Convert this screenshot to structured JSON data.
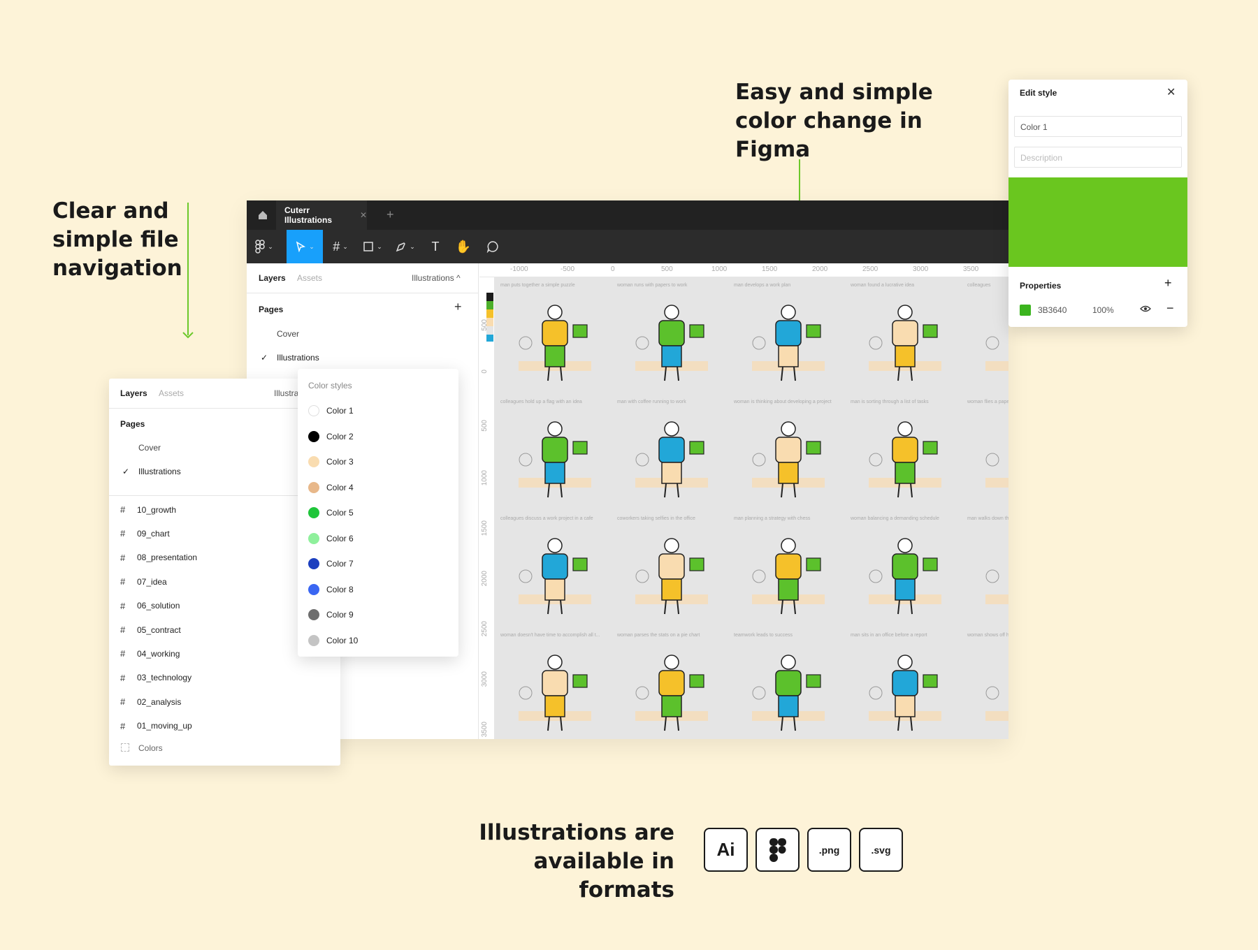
{
  "headings": {
    "left": "Clear and simple file navigation",
    "right": "Easy and simple color change in Figma",
    "bottom": "Illustrations are available in formats"
  },
  "figma": {
    "tab_title": "Cuterr Illustrations",
    "panel_tabs": [
      "Layers",
      "Assets"
    ],
    "page_dropdown": "Illustrations ^",
    "pages_label": "Pages",
    "pages": [
      "Cover",
      "Illustrations"
    ],
    "ruler_top": [
      "-1000",
      "-500",
      "0",
      "500",
      "1000",
      "1500",
      "2000",
      "2500",
      "3000",
      "3500"
    ],
    "ruler_left": [
      "500",
      "0",
      "500",
      "1000",
      "1500",
      "2000",
      "2500",
      "3000",
      "3500"
    ],
    "captions": [
      "man puts together a simple puzzle",
      "woman runs with papers to work",
      "man develops a work plan",
      "woman found a lucrative idea",
      "colleagues",
      "colleagues hold up a flag with an idea",
      "man with coffee running to work",
      "woman is thinking about developing a project",
      "man is sorting through a list of tasks",
      "woman flies a paper airplane",
      "colleagues discuss a work project in a cafe",
      "coworkers taking selfies in the office",
      "man planning a strategy with chess",
      "woman balancing a demanding schedule",
      "man walks down the stairs with his work done",
      "woman doesn't have time to accomplish all t...",
      "woman parses the stats on a pie chart",
      "teamwork leads to success",
      "man sits in an office before a report",
      "woman shows off her big to-do list"
    ]
  },
  "layers_panel": {
    "tabs": [
      "Layers",
      "Assets"
    ],
    "dropdown": "Illustra",
    "pages_label": "Pages",
    "pages": [
      "Cover",
      "Illustrations"
    ],
    "frames": [
      "10_growth",
      "09_chart",
      "08_presentation",
      "07_idea",
      "06_solution",
      "05_contract",
      "04_working",
      "03_technology",
      "02_analysis",
      "01_moving_up"
    ],
    "colors_item": "Colors"
  },
  "color_styles": {
    "title": "Color styles",
    "items": [
      {
        "label": "Color 1",
        "color": "#ffffff"
      },
      {
        "label": "Color 2",
        "color": "#000000"
      },
      {
        "label": "Color 3",
        "color": "#f9dcb0"
      },
      {
        "label": "Color 4",
        "color": "#e8b88a"
      },
      {
        "label": "Color 5",
        "color": "#1fc53a"
      },
      {
        "label": "Color 6",
        "color": "#8ff09c"
      },
      {
        "label": "Color 7",
        "color": "#1c3fbf"
      },
      {
        "label": "Color 8",
        "color": "#3a66f2"
      },
      {
        "label": "Color 9",
        "color": "#6e6e6e"
      },
      {
        "label": "Color 10",
        "color": "#c4c4c4"
      }
    ]
  },
  "edit_style": {
    "title": "Edit style",
    "name_value": "Color 1",
    "description_placeholder": "Description",
    "preview_color": "#6ac61f",
    "properties_label": "Properties",
    "hex": "3B3640",
    "opacity": "100%"
  },
  "formats": [
    "Ai",
    "Figma",
    ".png",
    ".svg"
  ],
  "colors": {
    "background": "#fdf3d8",
    "accent_green": "#6cc82a",
    "illustration_yellow": "#f5c12a",
    "figma_blue": "#18a0fb"
  }
}
